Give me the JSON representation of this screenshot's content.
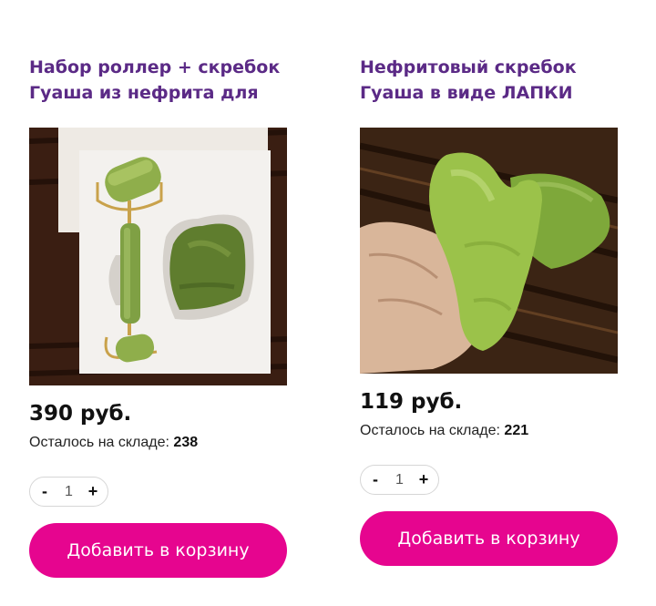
{
  "colors": {
    "title": "#5b2a86",
    "accent": "#e6058f"
  },
  "products": [
    {
      "title": "Набор роллер + скребок Гуаша из нефрита для",
      "image_icon": "jade-roller-set-image",
      "price": "390 руб.",
      "stock_label": "Осталось на складе:",
      "stock_value": "238",
      "qty_minus": "-",
      "qty_value": "1",
      "qty_plus": "+",
      "add_label": "Добавить в корзину"
    },
    {
      "title": "Нефритовый скребок Гуаша в виде ЛАПКИ",
      "image_icon": "jade-paw-scraper-image",
      "price": "119 руб.",
      "stock_label": "Осталось на складе:",
      "stock_value": "221",
      "qty_minus": "-",
      "qty_value": "1",
      "qty_plus": "+",
      "add_label": "Добавить в корзину"
    }
  ]
}
